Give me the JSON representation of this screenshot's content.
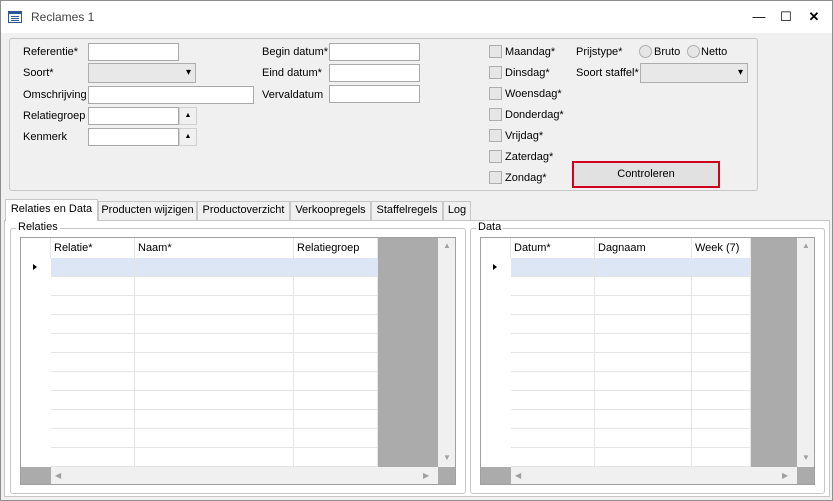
{
  "window": {
    "title": "Reclames 1",
    "controls": {
      "minimize": "—",
      "maximize": "☐",
      "close": "✕"
    }
  },
  "filters": {
    "referentie_label": "Referentie*",
    "soort_label": "Soort*",
    "omschrijving_label": "Omschrijving",
    "relatiegroep_label": "Relatiegroep",
    "kenmerk_label": "Kenmerk",
    "begin_datum_label": "Begin datum*",
    "eind_datum_label": "Eind datum*",
    "vervaldatum_label": "Vervaldatum",
    "days": [
      "Maandag*",
      "Dinsdag*",
      "Woensdag*",
      "Donderdag*",
      "Vrijdag*",
      "Zaterdag*",
      "Zondag*"
    ],
    "prijstype_label": "Prijstype*",
    "prijstype_options": [
      "Bruto",
      "Netto"
    ],
    "soort_staffel_label": "Soort staffel*",
    "controleren_button": "Controleren"
  },
  "tabs": [
    "Relaties en Data",
    "Producten wijzigen",
    "Productoverzicht",
    "Verkoopregels",
    "Staffelregels",
    "Log"
  ],
  "active_tab": "Relaties en Data",
  "relaties": {
    "group_title": "Relaties",
    "columns": [
      "Relatie*",
      "Naam*",
      "Relatiegroep"
    ]
  },
  "data": {
    "group_title": "Data",
    "columns": [
      "Datum*",
      "Dagnaam",
      "Week (7)"
    ]
  },
  "icons": {
    "app": "form-icon",
    "current_row": "row-indicator-arrow-icon",
    "dropdown": "chevron-down-icon",
    "spin_up": "spin-up-icon"
  },
  "colors": {
    "highlight_border": "#d0021b",
    "selected_row": "#dce6f4"
  }
}
